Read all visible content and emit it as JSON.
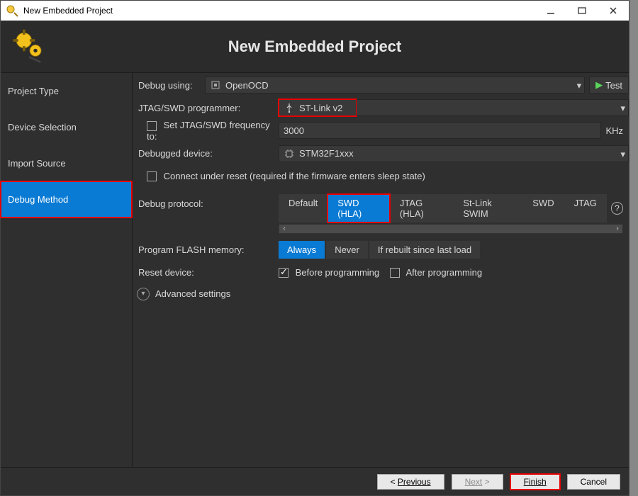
{
  "window": {
    "title": "New Embedded Project"
  },
  "header": {
    "title": "New Embedded Project"
  },
  "sidebar": {
    "items": [
      "Project Type",
      "Device Selection",
      "Import Source",
      "Debug Method"
    ],
    "active_index": 3
  },
  "debug_using": {
    "label": "Debug using:",
    "value": "OpenOCD",
    "test_label": "Test"
  },
  "programmer": {
    "label": "JTAG/SWD programmer:",
    "value": "ST-Link v2"
  },
  "frequency": {
    "checkbox_label": "Set JTAG/SWD frequency to:",
    "checked": false,
    "value": "3000",
    "unit": "KHz"
  },
  "device": {
    "label": "Debugged device:",
    "value": "STM32F1xxx"
  },
  "connect_reset": {
    "label": "Connect under reset (required if the firmware enters sleep state)",
    "checked": false
  },
  "protocol": {
    "label": "Debug protocol:",
    "options": [
      "Default",
      "SWD (HLA)",
      "JTAG (HLA)",
      "St-Link SWIM",
      "SWD",
      "JTAG"
    ],
    "selected_index": 1
  },
  "flash": {
    "label": "Program FLASH memory:",
    "options": [
      "Always",
      "Never",
      "If rebuilt since last load"
    ],
    "selected_index": 0
  },
  "reset": {
    "label": "Reset device:",
    "before": {
      "label": "Before programming",
      "checked": true
    },
    "after": {
      "label": "After programming",
      "checked": false
    }
  },
  "advanced": {
    "label": "Advanced settings"
  },
  "footer": {
    "previous": "Previous",
    "next": "Next",
    "finish": "Finish",
    "cancel": "Cancel"
  }
}
